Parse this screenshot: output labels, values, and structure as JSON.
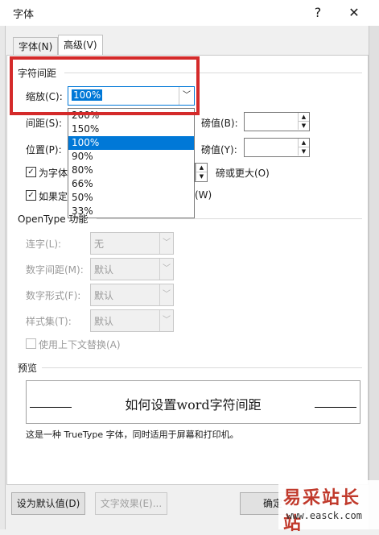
{
  "window": {
    "title": "字体",
    "help": "?",
    "close": "✕"
  },
  "tabs": [
    {
      "label": "字体(N)"
    },
    {
      "label": "高级(V)"
    }
  ],
  "spacing": {
    "group_label": "字符间距",
    "scale_label": "缩放(C):",
    "scale_value": "100%",
    "spacing_label": "间距(S):",
    "position_label": "位置(P):",
    "by_label_1": "磅值(B):",
    "by_label_2": "磅值(Y):",
    "kerning_label": "为字体",
    "kerning_suffix": "磅或更大(O)",
    "grid_label": "如果定",
    "grid_suffix": "(W)"
  },
  "scale_options": [
    "200%",
    "150%",
    "100%",
    "90%",
    "80%",
    "66%",
    "50%",
    "33%"
  ],
  "scale_selected_index": 2,
  "opentype": {
    "group_label": "OpenType 功能",
    "ligatures_label": "连字(L):",
    "ligatures_value": "无",
    "num_spacing_label": "数字间距(M):",
    "num_spacing_value": "默认",
    "num_forms_label": "数字形式(F):",
    "num_forms_value": "默认",
    "style_sets_label": "样式集(T):",
    "style_sets_value": "默认",
    "contextual_label": "使用上下文替换(A)"
  },
  "preview": {
    "group_label": "预览",
    "text": "如何设置word字符间距",
    "note": "这是一种 TrueType 字体，同时适用于屏幕和打印机。"
  },
  "buttons": {
    "set_default": "设为默认值(D)",
    "text_effects": "文字效果(E)...",
    "ok": "确定"
  },
  "watermark": {
    "brand": "易采站长站",
    "url": "www.easck.com"
  }
}
